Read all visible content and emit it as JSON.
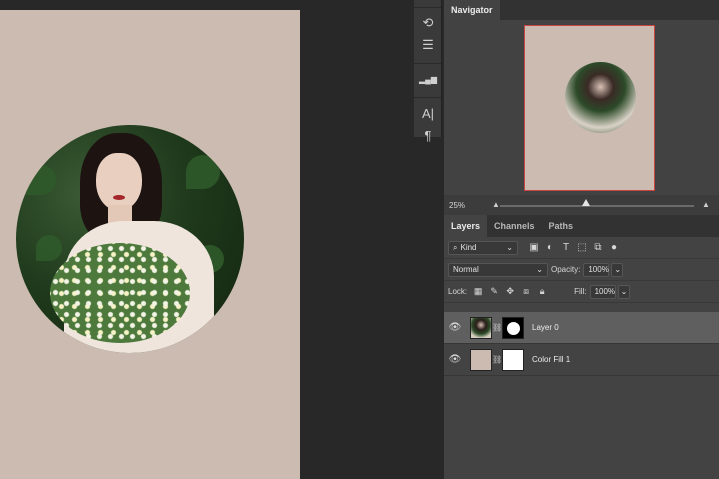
{
  "dock": {
    "icons": [
      "history-icon",
      "adjustments-icon",
      "histogram-icon",
      "character-icon",
      "paragraph-icon"
    ],
    "glyphs": [
      "⟲",
      "☰",
      "▂▄▆",
      "A|",
      "¶"
    ]
  },
  "navigator": {
    "tab_label": "Navigator",
    "zoom": "25%"
  },
  "layers_panel": {
    "tabs": [
      "Layers",
      "Channels",
      "Paths"
    ],
    "filter_kind": "Kind",
    "blend_mode": "Normal",
    "opacity_label": "Opacity:",
    "opacity_value": "100%",
    "lock_label": "Lock:",
    "fill_label": "Fill:",
    "fill_value": "100%",
    "layers": [
      {
        "name": "Layer 0",
        "selected": true
      },
      {
        "name": "Color Fill 1",
        "selected": false
      }
    ]
  },
  "colors": {
    "canvas_bg": "#cbbbb1",
    "app_bg": "#282828",
    "panel_bg": "#434343",
    "selection_outline": "#c94545"
  }
}
